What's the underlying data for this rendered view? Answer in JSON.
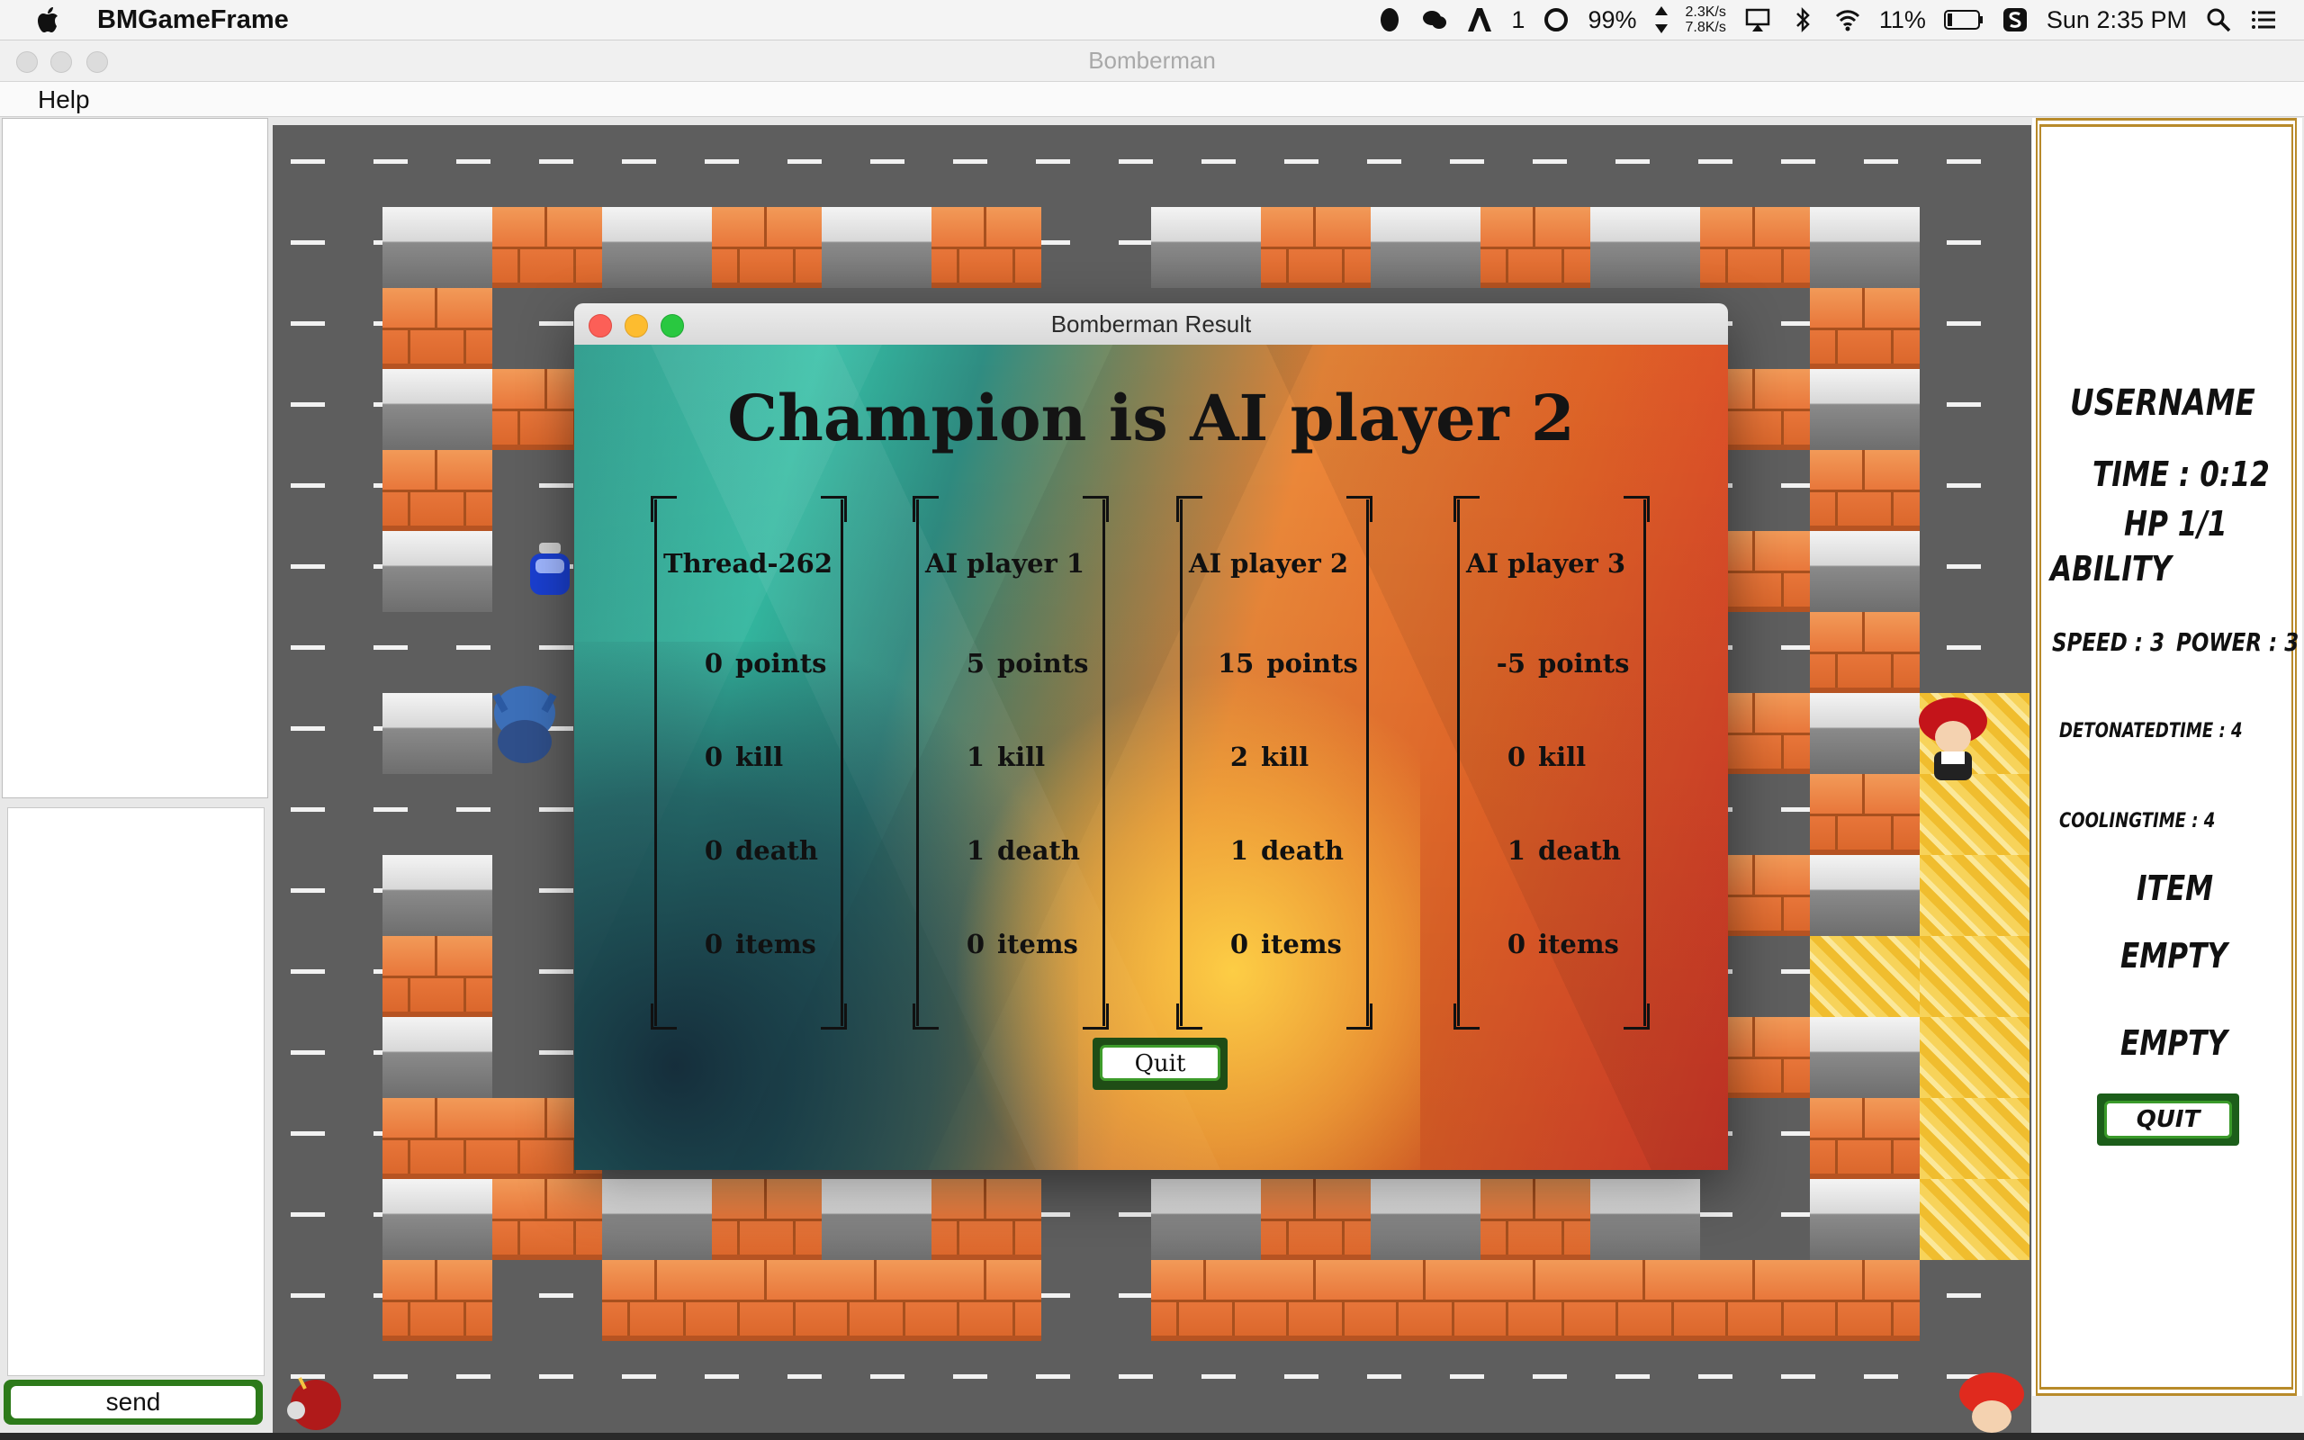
{
  "menubar": {
    "app_name": "BMGameFrame",
    "tray": {
      "notification_count": "1",
      "battery_status_percent": "99%",
      "net_up": "2.3K/s",
      "net_down": "7.8K/s",
      "battery_percent": "11%",
      "clock": "Sun 2:35 PM"
    }
  },
  "window": {
    "title": "Bomberman",
    "menu": {
      "help": "Help"
    }
  },
  "chat": {
    "send_label": "send"
  },
  "status_panel": {
    "username": "USERNAME",
    "time": "TIME : 0:12",
    "hp": "HP 1/1",
    "ability": "ABILITY",
    "speed": "SPEED : 3",
    "power": "POWER : 3",
    "detonated_time": "DETONATEDTIME : 4",
    "cooling_time": "COOLINGTIME : 4",
    "item_header": "ITEM",
    "item_slot_1": "EMPTY",
    "item_slot_2": "EMPTY",
    "quit_label": "QUIT"
  },
  "dialog": {
    "title": "Bomberman Result",
    "headline": "Champion is AI player 2",
    "quit_label": "Quit",
    "labels": {
      "points": "points",
      "kill": "kill",
      "death": "death",
      "items": "items"
    },
    "players": [
      {
        "name": "Thread-262",
        "points": "0",
        "kill": "0",
        "death": "0",
        "items": "0"
      },
      {
        "name": "AI player 1",
        "points": "5",
        "kill": "1",
        "death": "1",
        "items": "0"
      },
      {
        "name": "AI player 2",
        "points": "15",
        "kill": "2",
        "death": "1",
        "items": "0"
      },
      {
        "name": "AI player 3",
        "points": "-5",
        "kill": "0",
        "death": "1",
        "items": "0"
      }
    ]
  },
  "colors": {
    "brick": "#e8763a",
    "road": "#5e5e5e",
    "button_green": "#1f4d16",
    "panel_gold": "#b88a2a"
  }
}
